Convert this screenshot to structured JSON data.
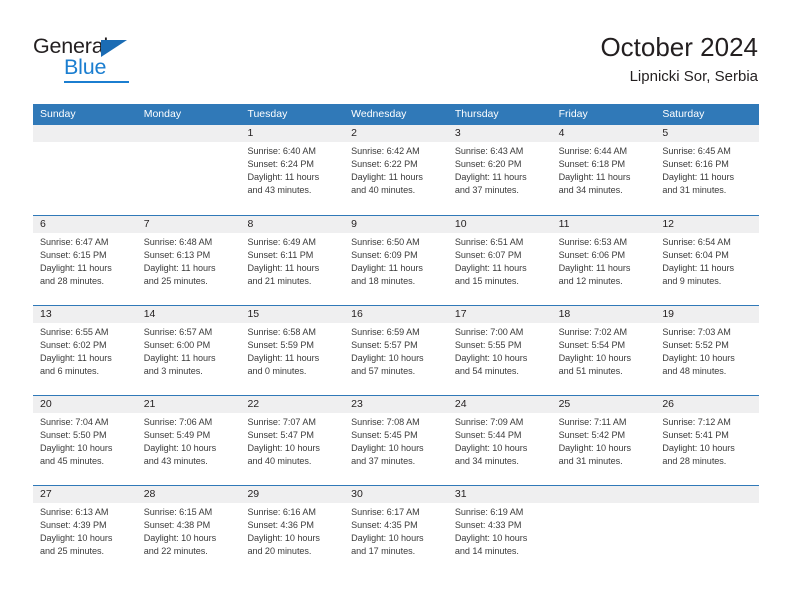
{
  "brand": {
    "name_top": "General",
    "name_bottom": "Blue",
    "accent_color": "#1b7ed0",
    "triangle_color": "#1b6cb4"
  },
  "header": {
    "title": "October 2024",
    "subtitle": "Lipnicki Sor, Serbia"
  },
  "theme": {
    "header_bar_color": "#3079b8",
    "day_band_color": "#efeff0",
    "text_color": "#231f20"
  },
  "weekdays": [
    "Sunday",
    "Monday",
    "Tuesday",
    "Wednesday",
    "Thursday",
    "Friday",
    "Saturday"
  ],
  "weeks": [
    [
      {
        "day": "",
        "lines": []
      },
      {
        "day": "",
        "lines": []
      },
      {
        "day": "1",
        "lines": [
          "Sunrise: 6:40 AM",
          "Sunset: 6:24 PM",
          "Daylight: 11 hours",
          "and 43 minutes."
        ]
      },
      {
        "day": "2",
        "lines": [
          "Sunrise: 6:42 AM",
          "Sunset: 6:22 PM",
          "Daylight: 11 hours",
          "and 40 minutes."
        ]
      },
      {
        "day": "3",
        "lines": [
          "Sunrise: 6:43 AM",
          "Sunset: 6:20 PM",
          "Daylight: 11 hours",
          "and 37 minutes."
        ]
      },
      {
        "day": "4",
        "lines": [
          "Sunrise: 6:44 AM",
          "Sunset: 6:18 PM",
          "Daylight: 11 hours",
          "and 34 minutes."
        ]
      },
      {
        "day": "5",
        "lines": [
          "Sunrise: 6:45 AM",
          "Sunset: 6:16 PM",
          "Daylight: 11 hours",
          "and 31 minutes."
        ]
      }
    ],
    [
      {
        "day": "6",
        "lines": [
          "Sunrise: 6:47 AM",
          "Sunset: 6:15 PM",
          "Daylight: 11 hours",
          "and 28 minutes."
        ]
      },
      {
        "day": "7",
        "lines": [
          "Sunrise: 6:48 AM",
          "Sunset: 6:13 PM",
          "Daylight: 11 hours",
          "and 25 minutes."
        ]
      },
      {
        "day": "8",
        "lines": [
          "Sunrise: 6:49 AM",
          "Sunset: 6:11 PM",
          "Daylight: 11 hours",
          "and 21 minutes."
        ]
      },
      {
        "day": "9",
        "lines": [
          "Sunrise: 6:50 AM",
          "Sunset: 6:09 PM",
          "Daylight: 11 hours",
          "and 18 minutes."
        ]
      },
      {
        "day": "10",
        "lines": [
          "Sunrise: 6:51 AM",
          "Sunset: 6:07 PM",
          "Daylight: 11 hours",
          "and 15 minutes."
        ]
      },
      {
        "day": "11",
        "lines": [
          "Sunrise: 6:53 AM",
          "Sunset: 6:06 PM",
          "Daylight: 11 hours",
          "and 12 minutes."
        ]
      },
      {
        "day": "12",
        "lines": [
          "Sunrise: 6:54 AM",
          "Sunset: 6:04 PM",
          "Daylight: 11 hours",
          "and 9 minutes."
        ]
      }
    ],
    [
      {
        "day": "13",
        "lines": [
          "Sunrise: 6:55 AM",
          "Sunset: 6:02 PM",
          "Daylight: 11 hours",
          "and 6 minutes."
        ]
      },
      {
        "day": "14",
        "lines": [
          "Sunrise: 6:57 AM",
          "Sunset: 6:00 PM",
          "Daylight: 11 hours",
          "and 3 minutes."
        ]
      },
      {
        "day": "15",
        "lines": [
          "Sunrise: 6:58 AM",
          "Sunset: 5:59 PM",
          "Daylight: 11 hours",
          "and 0 minutes."
        ]
      },
      {
        "day": "16",
        "lines": [
          "Sunrise: 6:59 AM",
          "Sunset: 5:57 PM",
          "Daylight: 10 hours",
          "and 57 minutes."
        ]
      },
      {
        "day": "17",
        "lines": [
          "Sunrise: 7:00 AM",
          "Sunset: 5:55 PM",
          "Daylight: 10 hours",
          "and 54 minutes."
        ]
      },
      {
        "day": "18",
        "lines": [
          "Sunrise: 7:02 AM",
          "Sunset: 5:54 PM",
          "Daylight: 10 hours",
          "and 51 minutes."
        ]
      },
      {
        "day": "19",
        "lines": [
          "Sunrise: 7:03 AM",
          "Sunset: 5:52 PM",
          "Daylight: 10 hours",
          "and 48 minutes."
        ]
      }
    ],
    [
      {
        "day": "20",
        "lines": [
          "Sunrise: 7:04 AM",
          "Sunset: 5:50 PM",
          "Daylight: 10 hours",
          "and 45 minutes."
        ]
      },
      {
        "day": "21",
        "lines": [
          "Sunrise: 7:06 AM",
          "Sunset: 5:49 PM",
          "Daylight: 10 hours",
          "and 43 minutes."
        ]
      },
      {
        "day": "22",
        "lines": [
          "Sunrise: 7:07 AM",
          "Sunset: 5:47 PM",
          "Daylight: 10 hours",
          "and 40 minutes."
        ]
      },
      {
        "day": "23",
        "lines": [
          "Sunrise: 7:08 AM",
          "Sunset: 5:45 PM",
          "Daylight: 10 hours",
          "and 37 minutes."
        ]
      },
      {
        "day": "24",
        "lines": [
          "Sunrise: 7:09 AM",
          "Sunset: 5:44 PM",
          "Daylight: 10 hours",
          "and 34 minutes."
        ]
      },
      {
        "day": "25",
        "lines": [
          "Sunrise: 7:11 AM",
          "Sunset: 5:42 PM",
          "Daylight: 10 hours",
          "and 31 minutes."
        ]
      },
      {
        "day": "26",
        "lines": [
          "Sunrise: 7:12 AM",
          "Sunset: 5:41 PM",
          "Daylight: 10 hours",
          "and 28 minutes."
        ]
      }
    ],
    [
      {
        "day": "27",
        "lines": [
          "Sunrise: 6:13 AM",
          "Sunset: 4:39 PM",
          "Daylight: 10 hours",
          "and 25 minutes."
        ]
      },
      {
        "day": "28",
        "lines": [
          "Sunrise: 6:15 AM",
          "Sunset: 4:38 PM",
          "Daylight: 10 hours",
          "and 22 minutes."
        ]
      },
      {
        "day": "29",
        "lines": [
          "Sunrise: 6:16 AM",
          "Sunset: 4:36 PM",
          "Daylight: 10 hours",
          "and 20 minutes."
        ]
      },
      {
        "day": "30",
        "lines": [
          "Sunrise: 6:17 AM",
          "Sunset: 4:35 PM",
          "Daylight: 10 hours",
          "and 17 minutes."
        ]
      },
      {
        "day": "31",
        "lines": [
          "Sunrise: 6:19 AM",
          "Sunset: 4:33 PM",
          "Daylight: 10 hours",
          "and 14 minutes."
        ]
      },
      {
        "day": "",
        "lines": []
      },
      {
        "day": "",
        "lines": []
      }
    ]
  ]
}
